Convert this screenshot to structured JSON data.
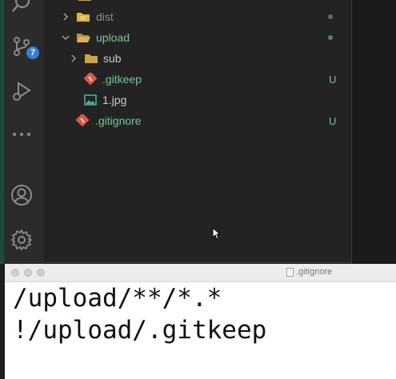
{
  "colors": {
    "activity_bar": "#2b2b2b",
    "sidebar": "#232323",
    "untracked_green": "#73c991",
    "folder_dim": "#c8a04a",
    "badge_blue": "#2f7fd6"
  },
  "activity_bar": {
    "items": [
      {
        "icon": "search-icon"
      },
      {
        "icon": "source-control-icon",
        "badge": "7"
      },
      {
        "icon": "run-debug-icon"
      },
      {
        "icon": "more-icon"
      },
      {
        "icon": "account-icon"
      },
      {
        "icon": "settings-gear-icon"
      }
    ]
  },
  "explorer": {
    "items": [
      {
        "label": "dist",
        "type": "folder",
        "expanded": false,
        "status": "dot-grey"
      },
      {
        "label": "upload",
        "type": "folder",
        "expanded": true,
        "status": "dot-green"
      },
      {
        "label": "sub",
        "type": "folder",
        "expanded": false,
        "status": ""
      },
      {
        "label": ".gitkeep",
        "type": "git-file",
        "status": "U"
      },
      {
        "label": "1.jpg",
        "type": "image-file",
        "status": ""
      },
      {
        "label": ".gitignore",
        "type": "git-file",
        "status": "U"
      }
    ]
  },
  "text_window": {
    "title": ".gitignore",
    "lines": [
      "/upload/**/*.*",
      "!/upload/.gitkeep"
    ]
  }
}
